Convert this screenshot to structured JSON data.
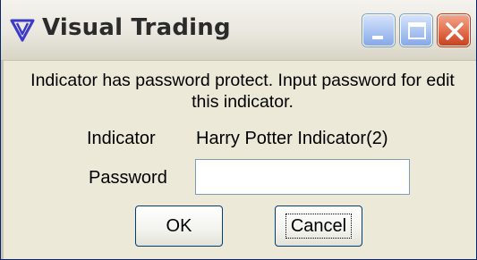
{
  "window": {
    "title": "Visual Trading",
    "app_icon": "visual-trading-logo-icon",
    "controls": {
      "minimize_icon": "minimize-icon",
      "maximize_icon": "maximize-icon",
      "close_icon": "close-icon"
    }
  },
  "dialog": {
    "message": "Indicator has password protect. Input password for edit this indicator.",
    "indicator_label": "Indicator",
    "indicator_value": "Harry Potter Indicator(2)",
    "password_label": "Password",
    "password_value": "",
    "ok_label": "OK",
    "cancel_label": "Cancel"
  },
  "colors": {
    "titlebar": "#ece9d8",
    "body": "#ece9d8",
    "close_button": "#e26c4a",
    "control_button": "#a6c1f0",
    "logo": "#3d39c8"
  }
}
